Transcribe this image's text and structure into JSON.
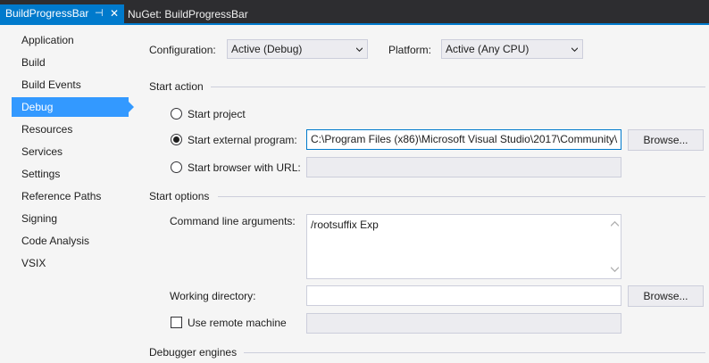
{
  "tabs": [
    {
      "label": "BuildProgressBar",
      "active": true,
      "pin_icon": "⊣",
      "close_icon": "✕"
    },
    {
      "label": "NuGet: BuildProgressBar",
      "active": false
    }
  ],
  "sidebar": {
    "items": [
      {
        "label": "Application"
      },
      {
        "label": "Build"
      },
      {
        "label": "Build Events"
      },
      {
        "label": "Debug",
        "selected": true
      },
      {
        "label": "Resources"
      },
      {
        "label": "Services"
      },
      {
        "label": "Settings"
      },
      {
        "label": "Reference Paths"
      },
      {
        "label": "Signing"
      },
      {
        "label": "Code Analysis"
      },
      {
        "label": "VSIX"
      }
    ]
  },
  "config": {
    "configuration_label": "Configuration:",
    "configuration_value": "Active (Debug)",
    "platform_label": "Platform:",
    "platform_value": "Active (Any CPU)"
  },
  "start_action": {
    "title": "Start action",
    "start_project": "Start project",
    "start_external": "Start external program:",
    "external_path": "C:\\Program Files (x86)\\Microsoft Visual Studio\\2017\\Community\\",
    "browse_label": "Browse...",
    "start_browser": "Start browser with URL:",
    "browser_url": "",
    "selected_option": "start_external"
  },
  "start_options": {
    "title": "Start options",
    "cmd_args_label": "Command line arguments:",
    "cmd_args_value": "/rootsuffix Exp",
    "working_dir_label": "Working directory:",
    "working_dir_value": "",
    "browse_label": "Browse...",
    "remote_label": "Use remote machine",
    "remote_value": ""
  },
  "debugger_engines": {
    "title": "Debugger engines"
  },
  "colors": {
    "accent": "#007acc",
    "selection": "#3399ff",
    "tab_bg": "#2d2d30"
  }
}
